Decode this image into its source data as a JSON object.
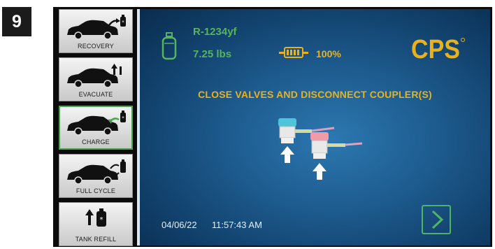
{
  "step": "9",
  "sidebar": {
    "items": [
      {
        "label": "RECOVERY",
        "icon": "car-recovery-icon",
        "active": false
      },
      {
        "label": "EVACUATE",
        "icon": "car-evacuate-icon",
        "active": false
      },
      {
        "label": "CHARGE",
        "icon": "car-charge-icon",
        "active": true
      },
      {
        "label": "FULL CYCLE",
        "icon": "car-full-cycle-icon",
        "active": false
      },
      {
        "label": "TANK REFILL",
        "icon": "tank-refill-icon",
        "active": false
      }
    ]
  },
  "screen": {
    "refrigerant": "R-1234yf",
    "tank_weight": "7.25 lbs",
    "battery_percent": "100%",
    "logo_text": "CPS",
    "instruction": "CLOSE VALVES AND DISCONNECT COUPLER(S)",
    "date": "04/06/22",
    "time": "11:57:43 AM",
    "next_icon": "chevron-right-icon"
  },
  "colors": {
    "accent_green": "#57b35e",
    "accent_yellow": "#e9b21c",
    "screen_blue": "#1d5a8d"
  }
}
